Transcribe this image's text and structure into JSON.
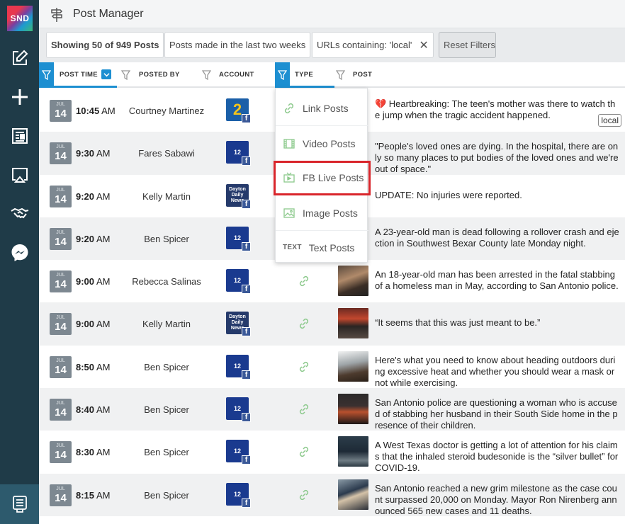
{
  "app": {
    "logo_text": "SND",
    "title": "Post Manager"
  },
  "sidebar": {
    "items": [
      {
        "name": "compose-icon"
      },
      {
        "name": "plus-icon"
      },
      {
        "name": "newspaper-icon"
      },
      {
        "name": "airplay-icon"
      },
      {
        "name": "handshake-icon"
      },
      {
        "name": "messenger-icon"
      },
      {
        "name": "post-manager-icon"
      }
    ]
  },
  "filters": {
    "showing": "Showing 50 of 949 Posts",
    "timeframe": "Posts made in the last two weeks",
    "url_filter": "URLs containing: 'local'",
    "url_filter_close": "✕",
    "reset": "Reset Filters"
  },
  "columns": {
    "post_time": "POST TIME",
    "posted_by": "POSTED BY",
    "account": "ACCOUNT",
    "type": "TYPE",
    "post": "POST"
  },
  "type_dropdown": {
    "items": [
      {
        "label": "Link Posts",
        "icon": "link-icon"
      },
      {
        "label": "Video Posts",
        "icon": "film-icon"
      },
      {
        "label": "FB Live Posts",
        "icon": "live-video-icon",
        "highlighted": true
      },
      {
        "label": "Image Posts",
        "icon": "image-icon"
      },
      {
        "label": "Text Posts",
        "icon_text": "TEXT"
      }
    ]
  },
  "rows": [
    {
      "month": "JUL",
      "day": "14",
      "time": "10:45",
      "ampm": "AM",
      "poster": "Courtney Martinez",
      "account": "wsb",
      "post": "💔 Heartbreaking: The teen's mother was there to watch the jump when the tragic accident happened.",
      "badge": "local"
    },
    {
      "month": "JUL",
      "day": "14",
      "time": "9:30",
      "ampm": "AM",
      "poster": "Fares Sabawi",
      "account": "ksat",
      "post": "\"People's loved ones are dying. In the hospital, there are only so many places to put bodies of the loved ones and we're out of space.\""
    },
    {
      "month": "JUL",
      "day": "14",
      "time": "9:20",
      "ampm": "AM",
      "poster": "Kelly Martin",
      "account": "ddn",
      "post": "UPDATE: No injuries were reported."
    },
    {
      "month": "JUL",
      "day": "14",
      "time": "9:20",
      "ampm": "AM",
      "poster": "Ben Spicer",
      "account": "ksat",
      "post": "A 23-year-old man is dead following a rollover crash and ejection in Southwest Bexar County late Monday night."
    },
    {
      "month": "JUL",
      "day": "14",
      "time": "9:00",
      "ampm": "AM",
      "poster": "Rebecca Salinas",
      "account": "ksat",
      "post": "An 18-year-old man has been arrested in the fatal stabbing of a homeless man in May, according to San Antonio police."
    },
    {
      "month": "JUL",
      "day": "14",
      "time": "9:00",
      "ampm": "AM",
      "poster": "Kelly Martin",
      "account": "ddn",
      "post": "“It seems that this was just meant to be.”"
    },
    {
      "month": "JUL",
      "day": "14",
      "time": "8:50",
      "ampm": "AM",
      "poster": "Ben Spicer",
      "account": "ksat",
      "post": "Here's what you need to know about heading outdoors during excessive heat and whether you should wear a mask or not while exercising."
    },
    {
      "month": "JUL",
      "day": "14",
      "time": "8:40",
      "ampm": "AM",
      "poster": "Ben Spicer",
      "account": "ksat",
      "post": "San Antonio police are questioning a woman who is accused of stabbing her husband in their South Side home in the presence of their children."
    },
    {
      "month": "JUL",
      "day": "14",
      "time": "8:30",
      "ampm": "AM",
      "poster": "Ben Spicer",
      "account": "ksat",
      "post": "A West Texas doctor is getting a lot of attention for his claims that the inhaled steroid budesonide is the “silver bullet” for COVID-19."
    },
    {
      "month": "JUL",
      "day": "14",
      "time": "8:15",
      "ampm": "AM",
      "poster": "Ben Spicer",
      "account": "ksat",
      "post": "San Antonio reached a new grim milestone as the case count surpassed 20,000 on Monday. Mayor Ron Nirenberg announced 565 new cases and 11 deaths."
    }
  ],
  "accounts": {
    "wsb": {
      "label": "2"
    },
    "ksat": {
      "label": "12"
    },
    "ddn": {
      "label": "Dayton Daily News"
    }
  },
  "fb_badge": "f",
  "colors": {
    "sidebar": "#1f3b48",
    "accent": "#1d8fd1",
    "highlight": "#d9252b",
    "link_icon": "#8cc98c"
  }
}
